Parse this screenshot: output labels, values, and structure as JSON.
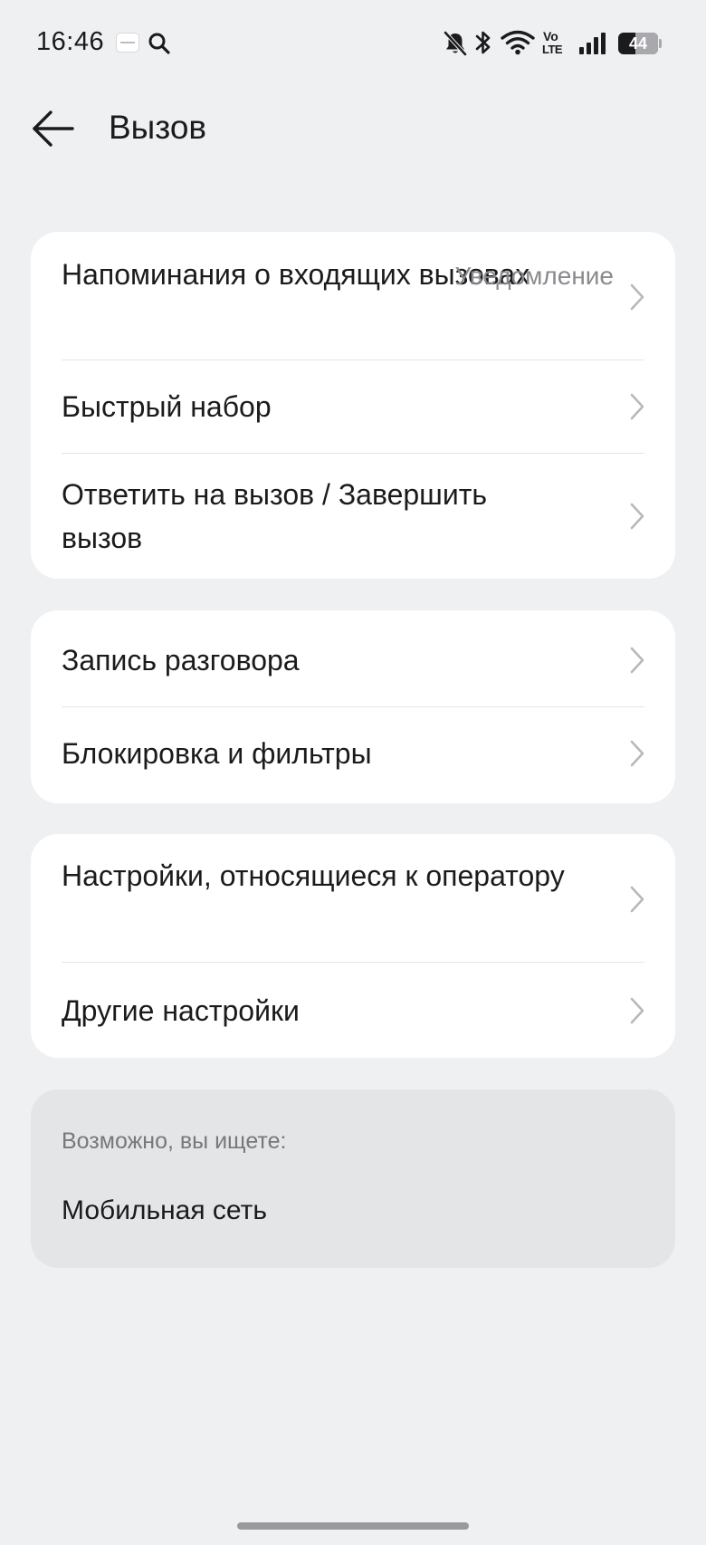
{
  "status_bar": {
    "time": "16:46",
    "icons": [
      "app-notification-icon",
      "search-icon",
      "bell-muted-icon",
      "bluetooth-icon",
      "wifi-icon",
      "volte-icon",
      "cellular-signal-icon",
      "battery-icon"
    ],
    "volte_top": "Vo",
    "volte_bottom": "LTE",
    "battery_level": "44"
  },
  "header": {
    "title": "Вызов",
    "back_icon": "arrow-left-icon"
  },
  "groups": [
    {
      "items": [
        {
          "label": "Напоминания о входящих вызовах",
          "value": "Уведомление"
        },
        {
          "label": "Быстрый набор"
        },
        {
          "label": "Ответить на вызов / Завершить вызов"
        }
      ]
    },
    {
      "items": [
        {
          "label": "Запись разговора"
        },
        {
          "label": "Блокировка и фильтры"
        }
      ]
    },
    {
      "items": [
        {
          "label": "Настройки, относящиеся к оператору"
        },
        {
          "label": "Другие настройки"
        }
      ]
    }
  ],
  "suggestions": {
    "heading": "Возможно, вы ищете:",
    "items": [
      "Мобильная сеть"
    ]
  },
  "colors": {
    "background": "#eff0f2",
    "card": "#ffffff",
    "suggestion_card": "#e4e5e7",
    "text_primary": "#1b1b1d",
    "text_secondary": "#8a8a8e"
  }
}
